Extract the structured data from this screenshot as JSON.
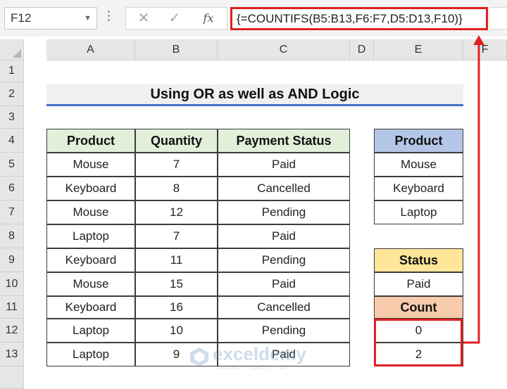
{
  "formula_bar": {
    "name_box": "F12",
    "cancel_icon": "✕",
    "enter_icon": "✓",
    "fx_label": "fx",
    "formula": "{=COUNTIFS(B5:B13,F6:F7,D5:D13,F10)}"
  },
  "columns": [
    "A",
    "B",
    "C",
    "D",
    "E",
    "F"
  ],
  "rows": [
    "1",
    "2",
    "3",
    "4",
    "5",
    "6",
    "7",
    "8",
    "9",
    "10",
    "11",
    "12",
    "13"
  ],
  "title": "Using OR as well as AND Logic",
  "table": {
    "headers": [
      "Product",
      "Quantity",
      "Payment Status"
    ],
    "rows": [
      [
        "Mouse",
        "7",
        "Paid"
      ],
      [
        "Keyboard",
        "8",
        "Cancelled"
      ],
      [
        "Mouse",
        "12",
        "Pending"
      ],
      [
        "Laptop",
        "7",
        "Paid"
      ],
      [
        "Keyboard",
        "11",
        "Pending"
      ],
      [
        "Mouse",
        "15",
        "Paid"
      ],
      [
        "Keyboard",
        "16",
        "Cancelled"
      ],
      [
        "Laptop",
        "10",
        "Pending"
      ],
      [
        "Laptop",
        "9",
        "Paid"
      ]
    ]
  },
  "criteria": {
    "product_header": "Product",
    "products": [
      "Mouse",
      "Keyboard",
      "Laptop"
    ],
    "status_header": "Status",
    "status_value": "Paid",
    "count_header": "Count",
    "count_values": [
      "0",
      "2"
    ]
  },
  "watermark": {
    "brand": "exceldemy",
    "tagline": "EXCEL · DATA · BI"
  },
  "colors": {
    "highlight": "#e02020",
    "title_underline": "#4472c4",
    "table_header": "#e2efda",
    "product_header": "#b4c6e7",
    "status_header": "#ffe699",
    "count_header": "#f8cbad"
  }
}
